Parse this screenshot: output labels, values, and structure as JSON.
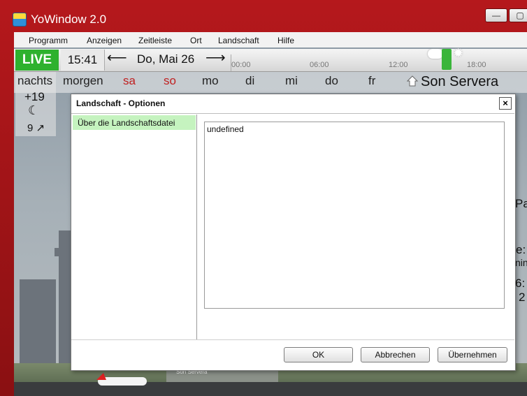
{
  "window": {
    "title": "YoWindow 2.0"
  },
  "menu": [
    "Programm",
    "Anzeigen",
    "Zeitleiste",
    "Ort",
    "Landschaft",
    "Hilfe"
  ],
  "timeline": {
    "live_label": "LIVE",
    "time": "15:41",
    "date": "Do, Mai 26",
    "ticks": [
      "00:00",
      "06:00",
      "12:00",
      "18:00"
    ]
  },
  "forecast": {
    "days": [
      {
        "label": "nachts",
        "weekend": false
      },
      {
        "label": "morgen",
        "weekend": false
      },
      {
        "label": "sa",
        "weekend": true
      },
      {
        "label": "so",
        "weekend": true
      },
      {
        "label": "mo",
        "weekend": false
      },
      {
        "label": "di",
        "weekend": false
      },
      {
        "label": "mi",
        "weekend": false
      },
      {
        "label": "do",
        "weekend": false
      },
      {
        "label": "fr",
        "weekend": false
      }
    ],
    "now_temp": "+19",
    "now_wind": "9 ↗",
    "location": "Son Servera",
    "accent": "#2eb12e",
    "weekend_color": "#c02020"
  },
  "background": {
    "side_fragments": [
      "Pa",
      "e:",
      "nin",
      "6:",
      "2"
    ],
    "airport_label": "Son Servera"
  },
  "dialog": {
    "title": "Landschaft - Optionen",
    "close_label": "×",
    "list_items": [
      "Über die Landschaftsdatei"
    ],
    "content_text": "undefined",
    "buttons": {
      "ok": "OK",
      "cancel": "Abbrechen",
      "apply": "Übernehmen"
    }
  }
}
